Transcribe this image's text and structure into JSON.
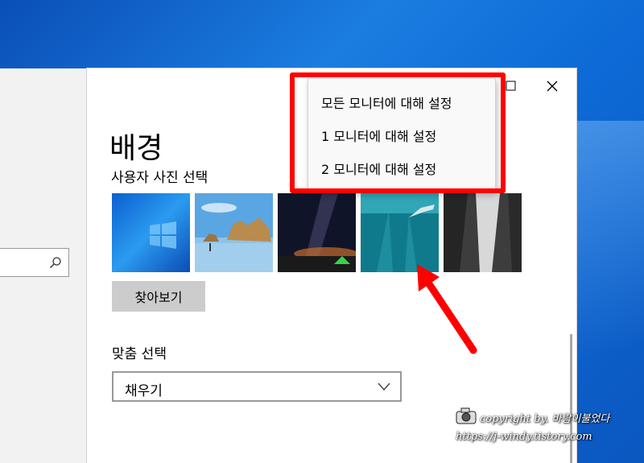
{
  "page": {
    "title": "배경",
    "choose_picture_label": "사용자 사진 선택",
    "browse_button": "찾아보기",
    "fit_label": "맞춤 선택",
    "fit_value": "채우기"
  },
  "context_menu": {
    "items": [
      "모든 모니터에 대해 설정",
      "1 모니터에 대해 설정",
      "2 모니터에 대해 설정"
    ]
  },
  "thumbnails": [
    "windows-default-blue",
    "beach-rocks",
    "milky-way-tent",
    "underwater-swimmer",
    "waterfall-cliff"
  ],
  "watermark": {
    "line1": "copyright by. 바람이불었다",
    "line2": "https://j-windy.tistory.com"
  },
  "colors": {
    "highlight": "#ff0000",
    "desktop": "#0b62cc",
    "button_bg": "#cccccc"
  }
}
